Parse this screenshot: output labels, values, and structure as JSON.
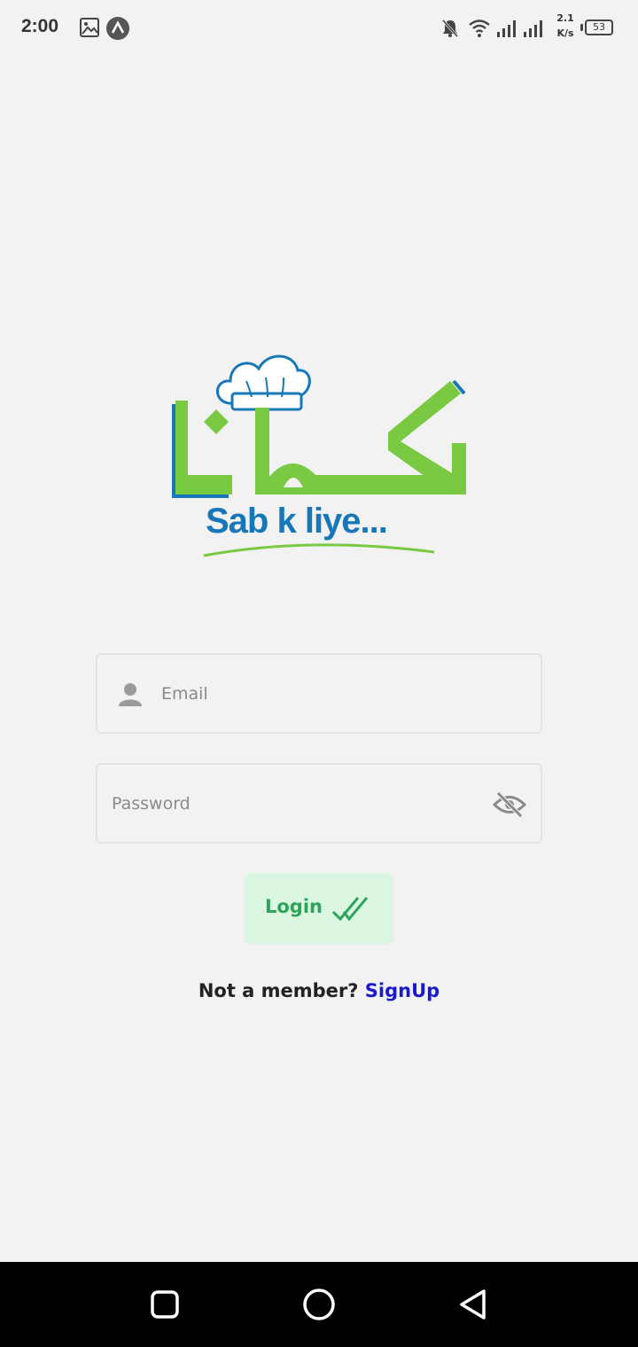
{
  "status_bar": {
    "time": "2:00",
    "speed_value": "2.1",
    "speed_unit": "K/s",
    "battery": "53",
    "icons": [
      "image-icon",
      "app-notification-icon",
      "bell-off-icon",
      "wifi-icon",
      "signal-icon",
      "signal-icon-2"
    ]
  },
  "logo": {
    "urdu_text": "کھانا",
    "tagline": "Sab k liye..."
  },
  "form": {
    "email_placeholder": "Email",
    "password_placeholder": "Password",
    "login_label": "Login"
  },
  "signup": {
    "question": "Not a member?",
    "link": "SignUp"
  },
  "colors": {
    "brand_green": "#7ac943",
    "brand_blue": "#1877b8",
    "login_bg": "#dcf7e1",
    "login_text": "#2ca45a",
    "link": "#1a1acc"
  },
  "nav_bar": {
    "icons": [
      "recents-square-icon",
      "home-circle-icon",
      "back-triangle-icon"
    ]
  }
}
